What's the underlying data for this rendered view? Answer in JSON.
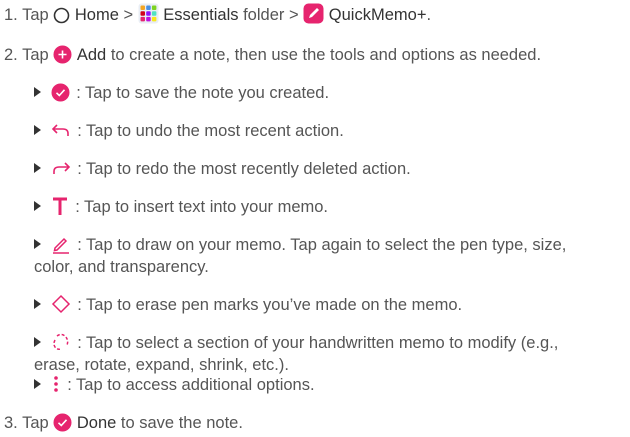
{
  "colors": {
    "accent": "#e6246e",
    "text": "#555555",
    "strong": "#333333"
  },
  "step1": {
    "num": "1.",
    "tap": "Tap",
    "home_icon": "circle-home-icon",
    "home": "Home",
    "sep1": ">",
    "folder_icon": "essentials-folder-icon",
    "folder": "Essentials",
    "folder_word": "folder",
    "sep2": ">",
    "app_icon": "quickmemo-icon",
    "app": "QuickMemo+",
    "end": "."
  },
  "step2": {
    "num": "2.",
    "tap": "Tap",
    "add_icon": "plus-circle-icon",
    "add": "Add",
    "rest": "to create a note, then use the tools and options as needed."
  },
  "tools": [
    {
      "icon": "checkmark-circle-icon",
      "text": ": Tap to save the note you created."
    },
    {
      "icon": "undo-arrow-icon",
      "text": ": Tap to undo the most recent action."
    },
    {
      "icon": "redo-arrow-icon",
      "text": ": Tap to redo the most recently deleted action."
    },
    {
      "icon": "text-t-icon",
      "text": ": Tap to insert text into your memo."
    },
    {
      "icon": "pen-icon",
      "text": ": Tap to draw on your memo. Tap again to select the pen type, size,",
      "cont": "color, and transparency."
    },
    {
      "icon": "eraser-icon",
      "text": ": Tap to erase pen marks you’ve made on the memo."
    },
    {
      "icon": "lasso-select-icon",
      "text": ": Tap to select a section of your handwritten memo to modify (e.g.,",
      "cont": "erase, rotate, expand, shrink, etc.)."
    },
    {
      "icon": "more-options-icon",
      "text": ": Tap to access additional options."
    }
  ],
  "step3": {
    "num": "3.",
    "tap": "Tap",
    "done_icon": "checkmark-circle-icon",
    "done": "Done",
    "rest": "to save the note."
  }
}
